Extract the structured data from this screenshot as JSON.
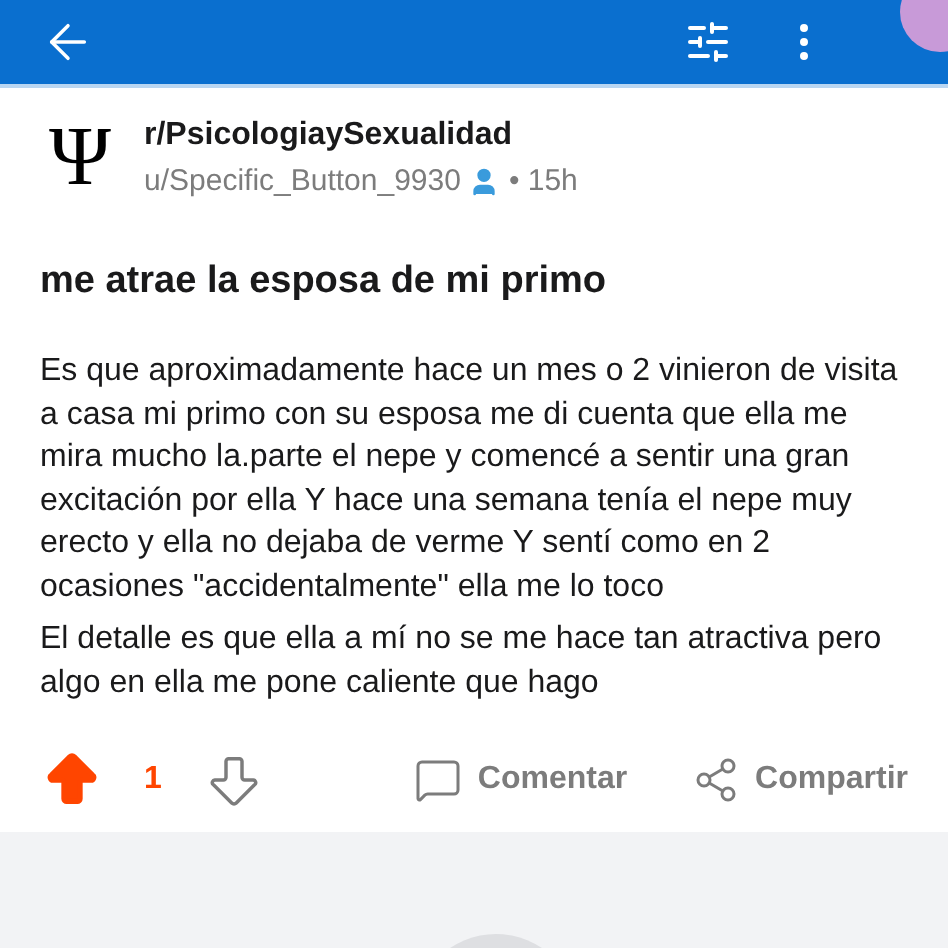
{
  "post": {
    "subreddit": "r/PsicologiaySexualidad",
    "subreddit_glyph": "Ψ",
    "author": "u/Specific_Button_9930",
    "time": "• 15h",
    "title": "me atrae la esposa de mi primo",
    "paragraphs": [
      "Es que aproximadamente hace un mes o 2 vinieron de visita a casa mi primo con su esposa me di cuenta que ella me mira mucho la.parte el nepe y comencé a sentir una gran excitación por ella Y hace una semana tenía el nepe muy erecto y ella no dejaba de verme Y sentí como en 2 ocasiones \"accidentalmente\" ella me lo toco",
      "El detalle es que ella a mí no se me hace tan atractiva pero algo en ella me pone caliente que hago"
    ]
  },
  "actions": {
    "upvoted": true,
    "score": "1",
    "comment": "Comentar",
    "share": "Compartir"
  }
}
